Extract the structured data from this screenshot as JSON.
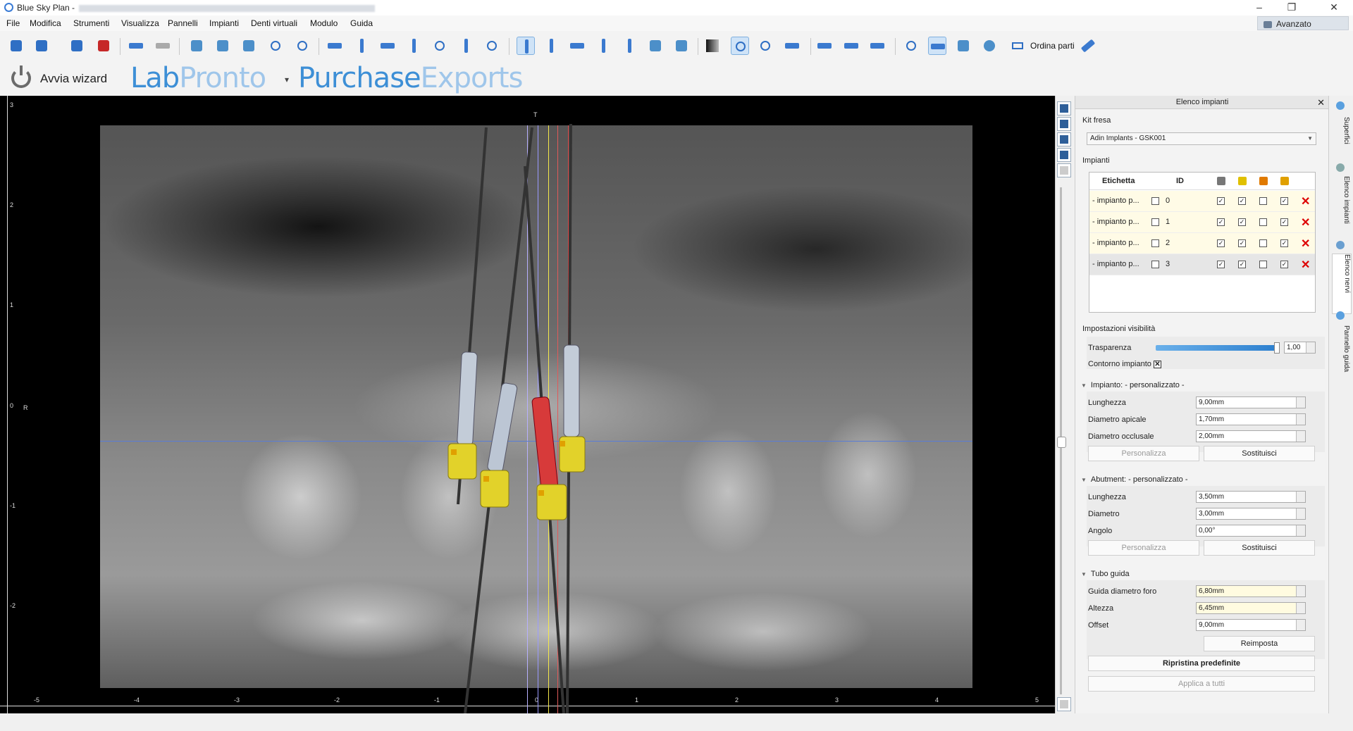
{
  "window": {
    "title": "Blue Sky Plan -",
    "controls": {
      "minimize": "–",
      "maximize": "❐",
      "close": "✕"
    }
  },
  "menu": [
    "File",
    "Modifica",
    "Strumenti",
    "Visualizza",
    "Pannelli",
    "Impianti",
    "Denti virtuali",
    "Modulo",
    "Guida"
  ],
  "avanzato": "Avanzato",
  "toolbar": {
    "ordina_label": "Ordina parti"
  },
  "subbar": {
    "wizard_label": "Avvia wizard",
    "brand1_a": "Lab",
    "brand1_b": "Pronto",
    "brand2_a": "Purchase",
    "brand2_b": "Exports"
  },
  "viewport": {
    "top_label": "T",
    "side_label": "R",
    "vertical_ticks": [
      "3",
      "2",
      "1",
      "0",
      "-1",
      "-2"
    ],
    "horizontal_ticks": [
      "-5",
      "-4",
      "-3",
      "-2",
      "-1",
      "0",
      "1",
      "2",
      "3",
      "4",
      "5"
    ]
  },
  "panel": {
    "title": "Elenco impianti",
    "kit_label": "Kit fresa",
    "kit_value": "Adin Implants - GSK001",
    "impianti_label": "Impianti",
    "table_headers": {
      "label": "Etichetta",
      "id": "ID"
    },
    "rows": [
      {
        "label": "- impianto p...",
        "id": "0"
      },
      {
        "label": "- impianto p...",
        "id": "1"
      },
      {
        "label": "- impianto p...",
        "id": "2"
      },
      {
        "label": "- impianto p...",
        "id": "3"
      }
    ],
    "visibility_label": "Impostazioni visibilità",
    "trasparenza_label": "Trasparenza",
    "trasparenza_value": "1,00",
    "contorno_label": "Contorno impianto",
    "impianto_section": "Impianto: - personalizzato -",
    "impianto_fields": [
      {
        "label": "Lunghezza",
        "value": "9,00mm"
      },
      {
        "label": "Diametro apicale",
        "value": "1,70mm"
      },
      {
        "label": "Diametro occlusale",
        "value": "2,00mm"
      }
    ],
    "abutment_section": "Abutment: - personalizzato -",
    "abutment_fields": [
      {
        "label": "Lunghezza",
        "value": "3,50mm"
      },
      {
        "label": "Diametro",
        "value": "3,00mm"
      },
      {
        "label": "Angolo",
        "value": "0,00°"
      }
    ],
    "personalizza": "Personalizza",
    "sostituisci": "Sostituisci",
    "tubo_section": "Tubo guida",
    "tubo_fields": [
      {
        "label": "Guida diametro foro",
        "value": "6,80mm"
      },
      {
        "label": "Altezza",
        "value": "6,45mm"
      },
      {
        "label": "Offset",
        "value": "9,00mm"
      }
    ],
    "reimposta": "Reimposta",
    "ripristina": "Ripristina predefinite",
    "applica": "Applica a tutti"
  },
  "side_tabs": [
    "Superfici",
    "Elenco impianti",
    "Elenco nervi",
    "Pannello guida"
  ],
  "colors": {
    "accent": "#3d8fd6",
    "delete": "#d00000",
    "implant_yellow": "#e2d22a",
    "implant_selected": "#d73a3a"
  }
}
